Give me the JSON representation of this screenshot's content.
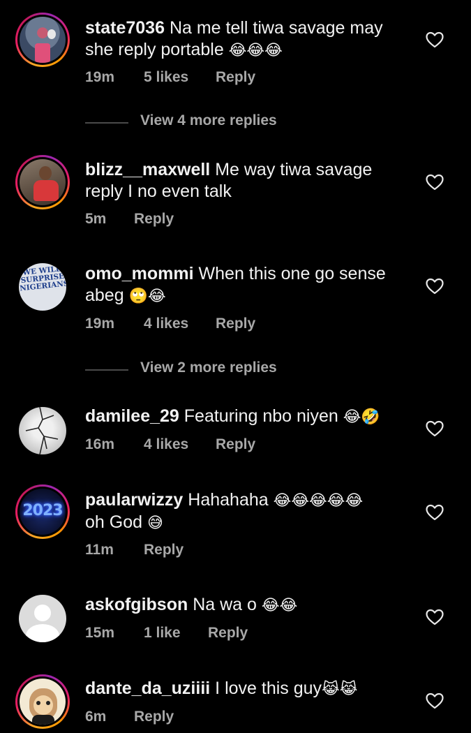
{
  "comments": [
    {
      "username": "state7036",
      "text": "Na me tell tiwa savage may she reply portable",
      "emoji": "😂😂😂",
      "time": "19m",
      "likes": "5 likes",
      "reply": "Reply"
    },
    {
      "username": "blizz__maxwell",
      "text": "Me way  tiwa savage reply I no even talk",
      "emoji": "",
      "time": "5m",
      "likes": "",
      "reply": "Reply"
    },
    {
      "username": "omo_mommi",
      "text": "When this one go sense abeg",
      "emoji": "🙄😂",
      "time": "19m",
      "likes": "4 likes",
      "reply": "Reply",
      "avatar_text": "WE WILL SURPRISE NIGERIANS"
    },
    {
      "username": "damilee_29",
      "text": "Featuring nbo niyen",
      "emoji": "😂🤣",
      "time": "16m",
      "likes": "4 likes",
      "reply": "Reply"
    },
    {
      "username": "paularwizzy",
      "text": "Hahahaha",
      "emoji": "😂😂😂😂😂",
      "text2": "oh God",
      "emoji2": "😅",
      "time": "11m",
      "likes": "",
      "reply": "Reply",
      "avatar_text": "2023"
    },
    {
      "username": "askofgibson",
      "text": "Na wa o",
      "emoji": "😂😂",
      "time": "15m",
      "likes": "1 like",
      "reply": "Reply"
    },
    {
      "username": "dante_da_uziiii",
      "text": "I love this guy",
      "emoji": "😹😹",
      "time": "6m",
      "likes": "",
      "reply": "Reply"
    }
  ],
  "view_more": [
    {
      "label": "View 4 more replies"
    },
    {
      "label": "View 2 more replies"
    }
  ],
  "colors": {
    "background": "#000000",
    "text": "#f2f2f2",
    "muted": "#a8a8a8",
    "story_ring": [
      "#f9a825",
      "#e91e63",
      "#9c27b0"
    ]
  },
  "icons": {
    "like": "heart-outline-icon"
  }
}
